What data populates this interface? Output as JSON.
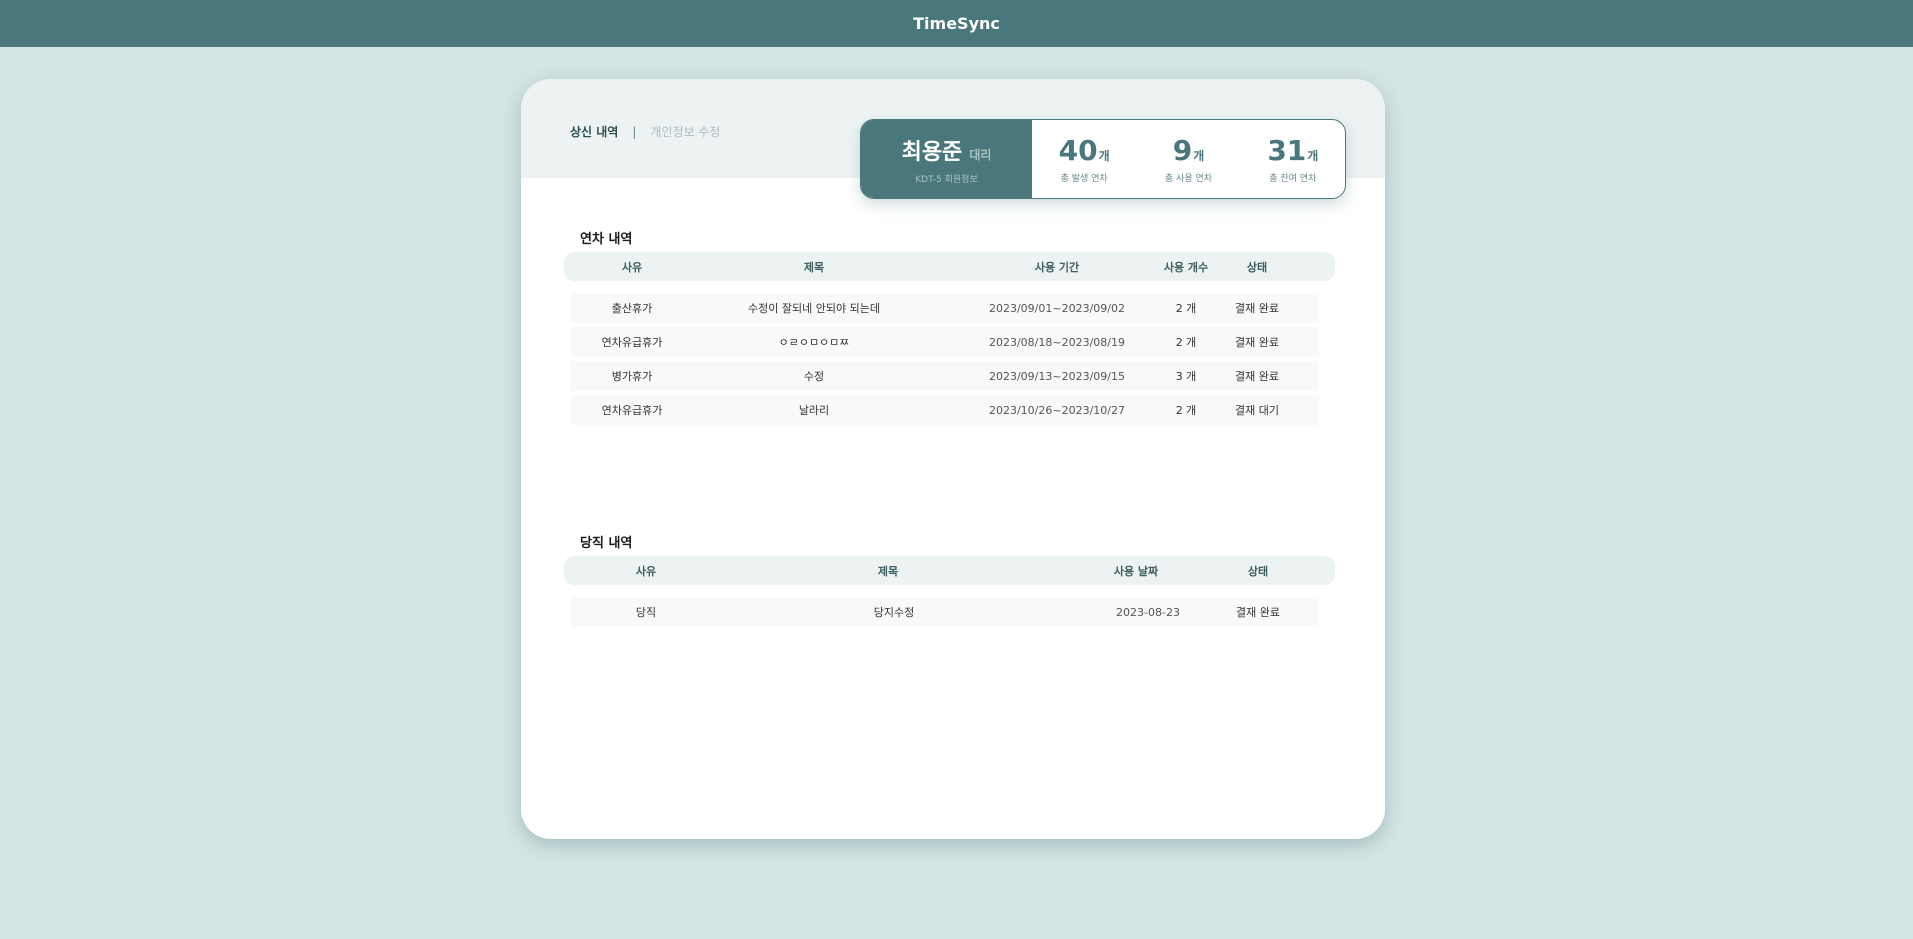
{
  "app": {
    "title": "TimeSync"
  },
  "nav": {
    "active": "상신 내역",
    "separator": "|",
    "inactive": "개인정보 수정"
  },
  "profile": {
    "name": "최용준",
    "rank": "대리",
    "dept": "KDT-5 회원정보",
    "stats": [
      {
        "value": "40",
        "unit": "개",
        "label": "총 발생 연차"
      },
      {
        "value": "9",
        "unit": "개",
        "label": "총 사용 연차"
      },
      {
        "value": "31",
        "unit": "개",
        "label": "총 잔여 연차"
      }
    ]
  },
  "annual": {
    "title": "연차 내역",
    "headers": [
      "사유",
      "제목",
      "사용 기간",
      "사용 개수",
      "상태"
    ],
    "rows": [
      [
        "출산휴가",
        "수정이 잘되네 안되야 되는데",
        "2023/09/01~2023/09/02",
        "2 개",
        "결재 완료"
      ],
      [
        "연차유급휴가",
        "ㅇㄹㅇㅁㅇㅁㅉ",
        "2023/08/18~2023/08/19",
        "2 개",
        "결재 완료"
      ],
      [
        "병가휴가",
        "수정",
        "2023/09/13~2023/09/15",
        "3 개",
        "결재 완료"
      ],
      [
        "연차유급휴가",
        "날라리",
        "2023/10/26~2023/10/27",
        "2 개",
        "결재 대기"
      ]
    ]
  },
  "duty": {
    "title": "당직 내역",
    "headers": [
      "사유",
      "제목",
      "사용 날짜",
      "상태"
    ],
    "rows": [
      [
        "당직",
        "당지수정",
        "2023-08-23",
        "결재 완료"
      ]
    ]
  },
  "colors": {
    "brand": "#4a777b",
    "background": "#d5e4e4",
    "panel": "#edf3f3"
  }
}
